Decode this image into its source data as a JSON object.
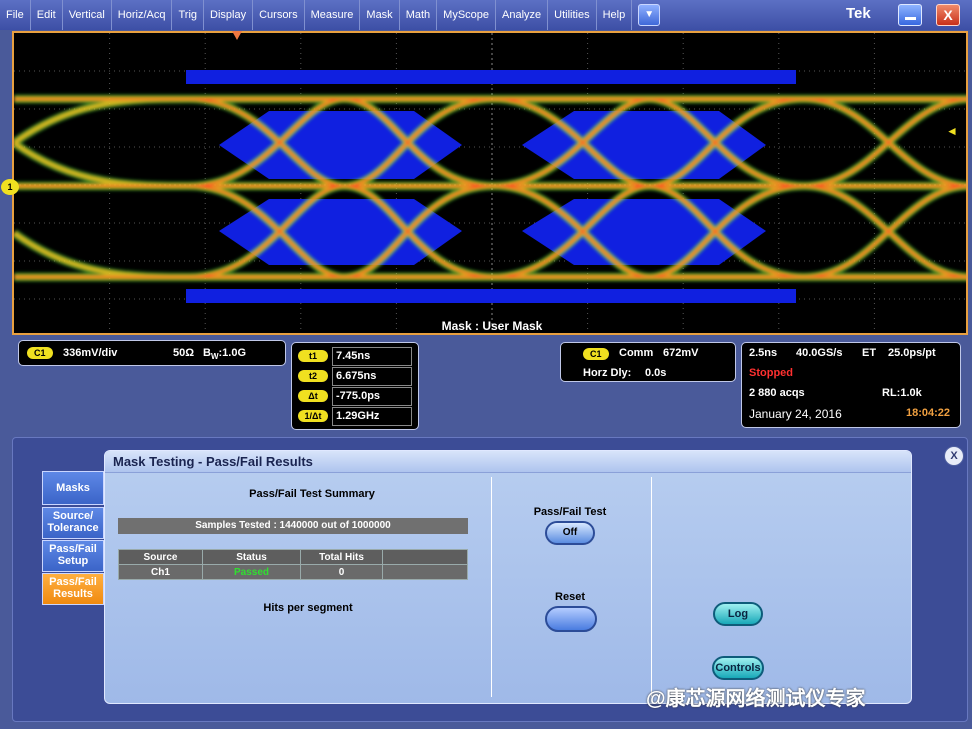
{
  "menu": {
    "items": [
      "File",
      "Edit",
      "Vertical",
      "Horiz/Acq",
      "Trig",
      "Display",
      "Cursors",
      "Measure",
      "Mask",
      "Math",
      "MyScope",
      "Analyze",
      "Utilities",
      "Help"
    ],
    "dropdown_glyph": "▼",
    "logo": "Tek",
    "close_glyph": "X"
  },
  "display": {
    "mask_label": "Mask : User Mask",
    "channel_marker": "1",
    "trigger_level_glyph": "◄"
  },
  "channel_readout": {
    "badge": "C1",
    "scale": "336mV/div",
    "impedance": "50Ω",
    "bw_prefix": "B",
    "bw_sub": "W",
    "bandwidth": ":1.0G"
  },
  "cursor_readout": {
    "rows": [
      {
        "label": "t1",
        "value": "7.45ns"
      },
      {
        "label": "t2",
        "value": "6.675ns"
      },
      {
        "label": "Δt",
        "value": "-775.0ps"
      },
      {
        "label": "1/Δt",
        "value": "1.29GHz"
      }
    ]
  },
  "trigger_readout": {
    "badge": "C1",
    "mode": "Comm",
    "level": "672mV",
    "horz_dly_label": "Horz Dly:",
    "horz_dly_value": "0.0s"
  },
  "acq_readout": {
    "timebase": "2.5ns",
    "sample_rate": "40.0GS/s",
    "mode": "ET",
    "resolution": "25.0ps/pt",
    "state": "Stopped",
    "acqs": "2 880 acqs",
    "record_length": "RL:1.0k",
    "date": "January 24, 2016",
    "time": "18:04:22"
  },
  "panel": {
    "title": "Mask Testing - Pass/Fail Results",
    "close_glyph": "X",
    "tabs": [
      {
        "label": "Masks"
      },
      {
        "label_line1": "Source/",
        "label_line2": "Tolerance"
      },
      {
        "label_line1": "Pass/Fail",
        "label_line2": "Setup"
      },
      {
        "label_line1": "Pass/Fail",
        "label_line2": "Results"
      }
    ],
    "summary_title": "Pass/Fail Test Summary",
    "samples_tested": "Samples Tested :   1440000 out of 1000000",
    "table": {
      "headers": [
        "Source",
        "Status",
        "Total Hits",
        ""
      ],
      "row": [
        "Ch1",
        "Passed",
        "0",
        ""
      ]
    },
    "hits_label": "Hits per segment",
    "pf_test_label": "Pass/Fail Test",
    "pf_test_state": "Off",
    "reset_label": "Reset",
    "log_label": "Log",
    "controls_label": "Controls"
  },
  "watermark": "@康芯源网络测试仪专家",
  "colors": {
    "mask": "#1020e0",
    "trace_hot": "#ff5020",
    "trace_warm": "#f0c020",
    "trace_cool": "#40ff40",
    "graticule_border": "#e8a040",
    "active_tab": "#f08a10",
    "stopped": "#ff3030",
    "time": "#f0a040"
  }
}
